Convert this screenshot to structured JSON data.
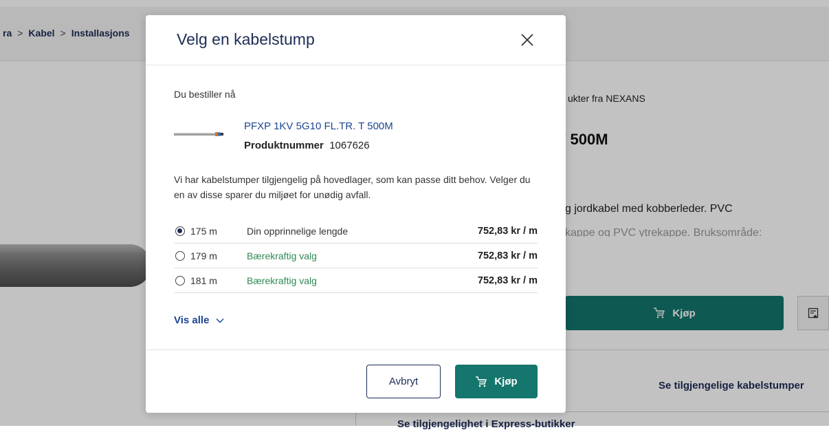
{
  "background": {
    "breadcrumb": [
      "ra",
      "Kabel",
      "Installasjons"
    ],
    "breadcrumb_separator": ">",
    "vendor_line": "ukter fra NEXANS",
    "product_heading": "T 500M",
    "description_line_1": "g jordkabel med kobberleder. PVC",
    "description_line_2": "kappe og PVC ytrekappe. Bruksområde:",
    "buy_label": "Kjøp",
    "stumper_link": "Se tilgjengelige kabelstumper",
    "express_link": "Se tilgjengelighet i Express-butikker"
  },
  "modal": {
    "title": "Velg en kabelstump",
    "ordering_label": "Du bestiller nå",
    "product_name": "PFXP 1KV 5G10 FL.TR. T 500M",
    "product_number_label": "Produktnummer",
    "product_number": "1067626",
    "info_text": "Vi har kabelstumper tilgjengelig på hovedlager, som kan passe ditt behov. Velger du en av disse sparer du miljøet for unødig avfall.",
    "options": [
      {
        "length": "175 m",
        "label": "Din opprinnelige lengde",
        "price": "752,83 kr / m",
        "selected": true,
        "sustainable": false
      },
      {
        "length": "179 m",
        "label": "Bærekraftig valg",
        "price": "752,83 kr / m",
        "selected": false,
        "sustainable": true
      },
      {
        "length": "181 m",
        "label": "Bærekraftig valg",
        "price": "752,83 kr / m",
        "selected": false,
        "sustainable": true
      }
    ],
    "show_all_label": "Vis alle",
    "cancel_label": "Avbryt",
    "buy_label": "Kjøp"
  },
  "colors": {
    "accent_teal": "#14766d",
    "navy": "#1d2c55",
    "link_blue": "#1d4590",
    "sustainable_green": "#2f8a54"
  },
  "icons": [
    "close-icon",
    "cart-icon",
    "chevron-down-icon",
    "radio-icon",
    "wishlist-icon"
  ]
}
